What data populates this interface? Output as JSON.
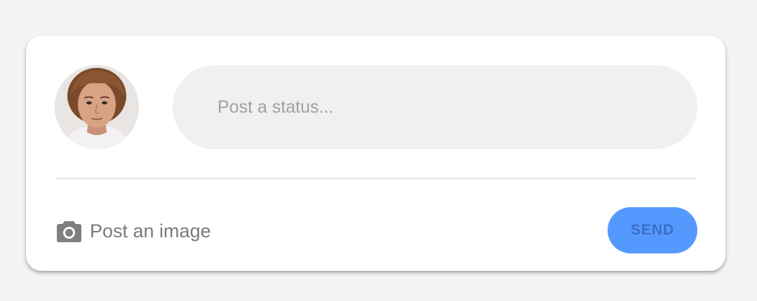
{
  "composer": {
    "status_placeholder": "Post a status...",
    "status_value": "",
    "post_image_label": "Post an image",
    "post_image_icon": "camera-icon",
    "send_label": "SEND"
  },
  "colors": {
    "background": "#f4f4f4",
    "card": "#ffffff",
    "input_fill": "#f0f0f0",
    "send_button": "#5599ff",
    "send_text": "#3b6fc4",
    "muted_text": "#7a7a7a"
  }
}
